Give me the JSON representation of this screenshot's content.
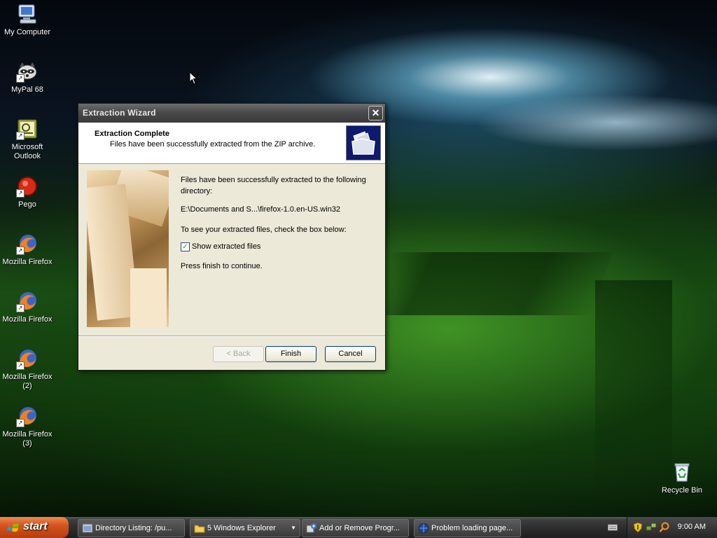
{
  "desktop": {
    "icons": [
      {
        "label": "My Computer"
      },
      {
        "label": "MyPal 68"
      },
      {
        "label": "Microsoft Outlook",
        "line1": "Microsoft",
        "line2": "Outlook"
      },
      {
        "label": "Pego"
      },
      {
        "label": "Mozilla Firefox"
      },
      {
        "label": "Mozilla Firefox"
      },
      {
        "label": "Mozilla Firefox (2)",
        "line1": "Mozilla Firefox",
        "line2": "(2)"
      },
      {
        "label": "Mozilla Firefox (3)",
        "line1": "Mozilla Firefox",
        "line2": "(3)"
      },
      {
        "label": "Recycle Bin"
      }
    ]
  },
  "dialog": {
    "title": "Extraction Wizard",
    "close_glyph": "✕",
    "header_title": "Extraction Complete",
    "header_subtitle": "Files have been successfully extracted from the ZIP archive.",
    "body_line1": "Files have been successfully extracted to the following",
    "body_line2": "directory:",
    "path": "E:\\Documents and S...\\firefox-1.0.en-US.win32",
    "check_prompt": "To see your extracted files, check the box below:",
    "checkbox_label": "Show extracted files",
    "checkbox_checked": true,
    "checkbox_glyph": "✓",
    "finish_prompt": "Press finish to continue.",
    "buttons": {
      "back": "< Back",
      "finish": "Finish",
      "cancel": "Cancel"
    }
  },
  "taskbar": {
    "start_label": "start",
    "tasks": [
      {
        "label": "Directory Listing: /pu..."
      },
      {
        "label": "5 Windows Explorer",
        "has_dropdown": true,
        "dropdown_glyph": "▼"
      },
      {
        "label": "Add or Remove Progr..."
      },
      {
        "label": "Problem loading page..."
      }
    ],
    "clock": "9:00 AM"
  },
  "colors": {
    "titlebar": "#3b3b3b",
    "dialog_bg": "#ece9d8",
    "start_button": "#d4541c",
    "taskbar": "#2b2b2b"
  }
}
